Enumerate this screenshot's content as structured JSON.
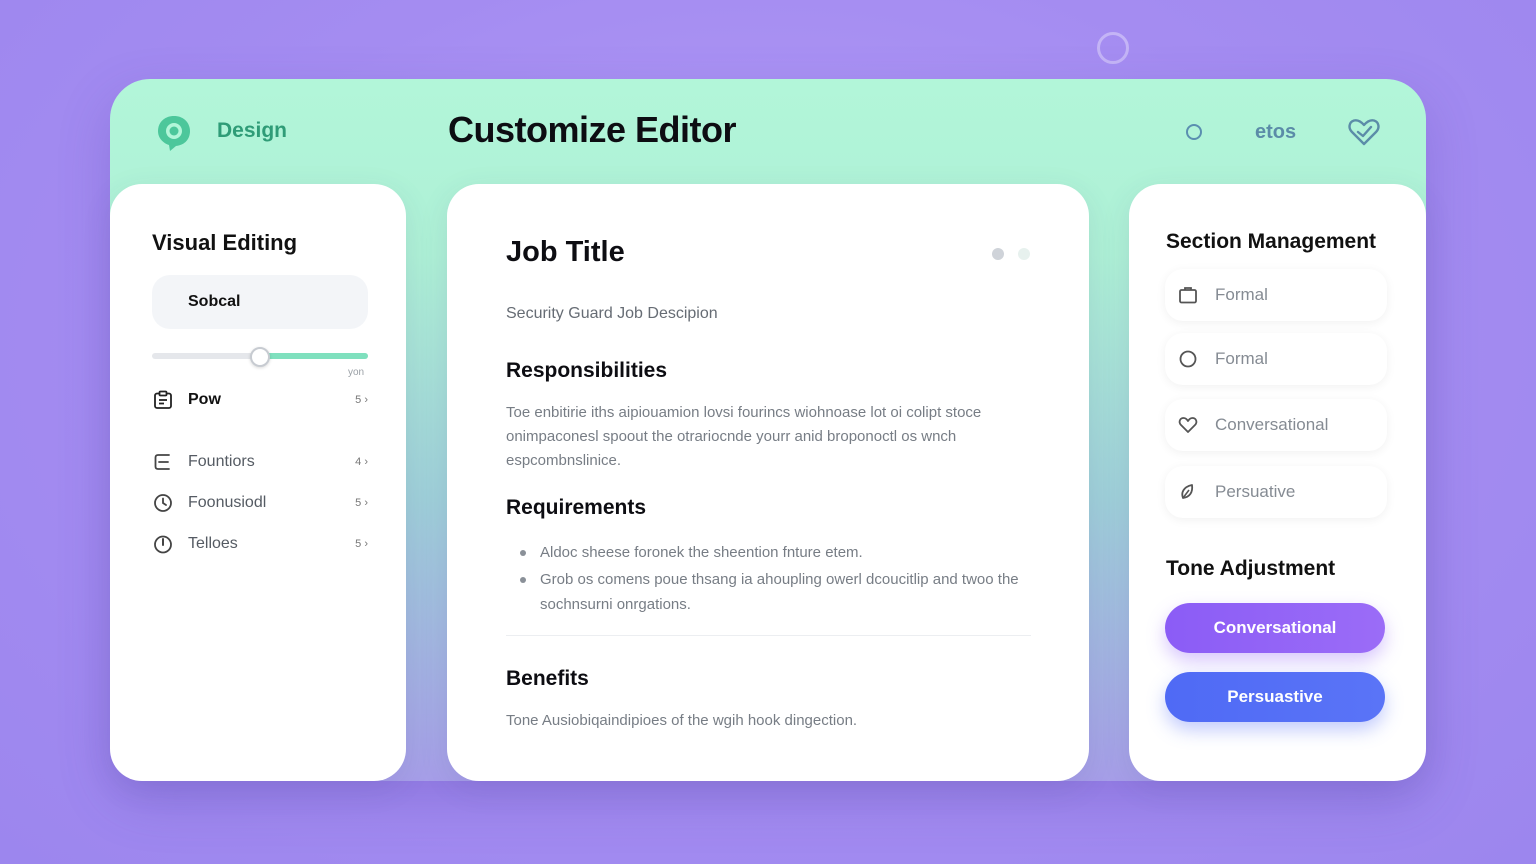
{
  "header": {
    "brand": "Design",
    "title": "Customize Editor",
    "right_text": "etos"
  },
  "left_panel": {
    "title": "Visual Editing",
    "input_value": "Sobcal",
    "slider": {
      "value": 0.5,
      "caption": "yon"
    },
    "items": [
      {
        "label": "Pow",
        "count": "5 ›",
        "icon": "clipboard-icon"
      },
      {
        "label": "Fountiors",
        "count": "4 ›",
        "icon": "menu-lines-icon"
      },
      {
        "label": "Foonusiodl",
        "count": "5 ›",
        "icon": "clock-icon"
      },
      {
        "label": "Telloes",
        "count": "5 ›",
        "icon": "timer-icon"
      }
    ]
  },
  "document": {
    "title": "Job Title",
    "subtitle": "Security Guard Job Descipion",
    "sections": {
      "responsibilities": {
        "heading": "Responsibilities",
        "text": "Toe enbitirie iths aipiouamion lovsi fourincs wiohnoase lot oi colipt stoce onimpaconesl spoout the otrariocnde yourr anid broponoctl os wnch espcombnslinice."
      },
      "requirements": {
        "heading": "Requirements",
        "items": [
          "Aldoc sheese foronek the sheention fnture etem.",
          "Grob os comens poue thsang ia ahoupling owerl dcoucitlip and twoo the sochnsurni onrgations."
        ]
      },
      "benefits": {
        "heading": "Benefits",
        "text": "Tone Ausiobiqaindipioes of the wgih hook dingection."
      }
    }
  },
  "right_panel": {
    "section_title": "Section Management",
    "options": [
      {
        "label": "Formal",
        "icon": "folder-icon"
      },
      {
        "label": "Formal",
        "icon": "circle-icon"
      },
      {
        "label": "Conversational",
        "icon": "heart-icon"
      },
      {
        "label": "Persuative",
        "icon": "leaf-icon"
      }
    ],
    "tone_title": "Tone Adjustment",
    "buttons": {
      "conversational": "Conversational",
      "persuastive": "Persuastive"
    }
  },
  "colors": {
    "accent_green": "#2f9c77",
    "violet": "#8b5cf6",
    "blue": "#4f6af5"
  }
}
